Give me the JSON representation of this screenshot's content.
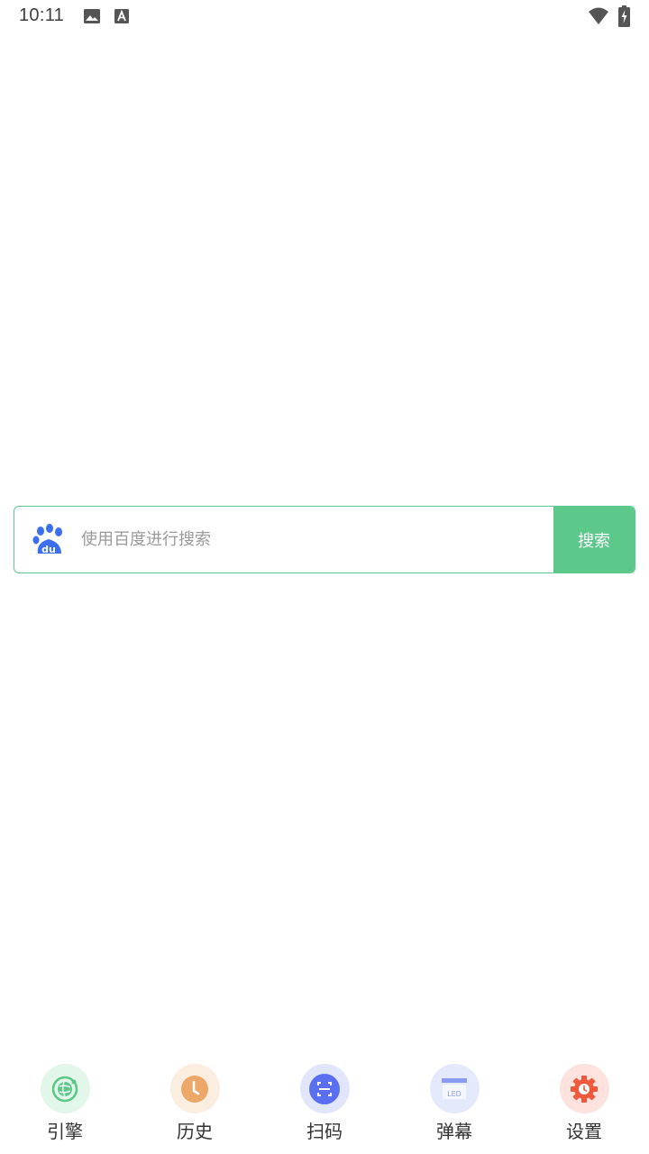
{
  "status_bar": {
    "time": "10:11",
    "icons": [
      "image-icon",
      "text-a-icon",
      "wifi-icon",
      "battery-charging-icon"
    ]
  },
  "search": {
    "engine_icon": "baidu-paw-icon",
    "placeholder": "使用百度进行搜索",
    "value": "",
    "button_label": "搜索",
    "accent_color": "#5cc88a"
  },
  "bottom_nav": {
    "items": [
      {
        "label": "引擎",
        "icon": "globe-icon",
        "color": "#5cc88a",
        "bg": "#e3f6ea"
      },
      {
        "label": "历史",
        "icon": "clock-icon",
        "color": "#eba868",
        "bg": "#fbede0"
      },
      {
        "label": "扫码",
        "icon": "scan-icon",
        "color": "#5a6ff0",
        "bg": "#e2e6fc"
      },
      {
        "label": "弹幕",
        "icon": "led-icon",
        "color": "#8a9cf2",
        "bg": "#e5e9fc",
        "icon_text": "LED"
      },
      {
        "label": "设置",
        "icon": "gear-icon",
        "color": "#ef5a3f",
        "bg": "#fde2de"
      }
    ]
  }
}
